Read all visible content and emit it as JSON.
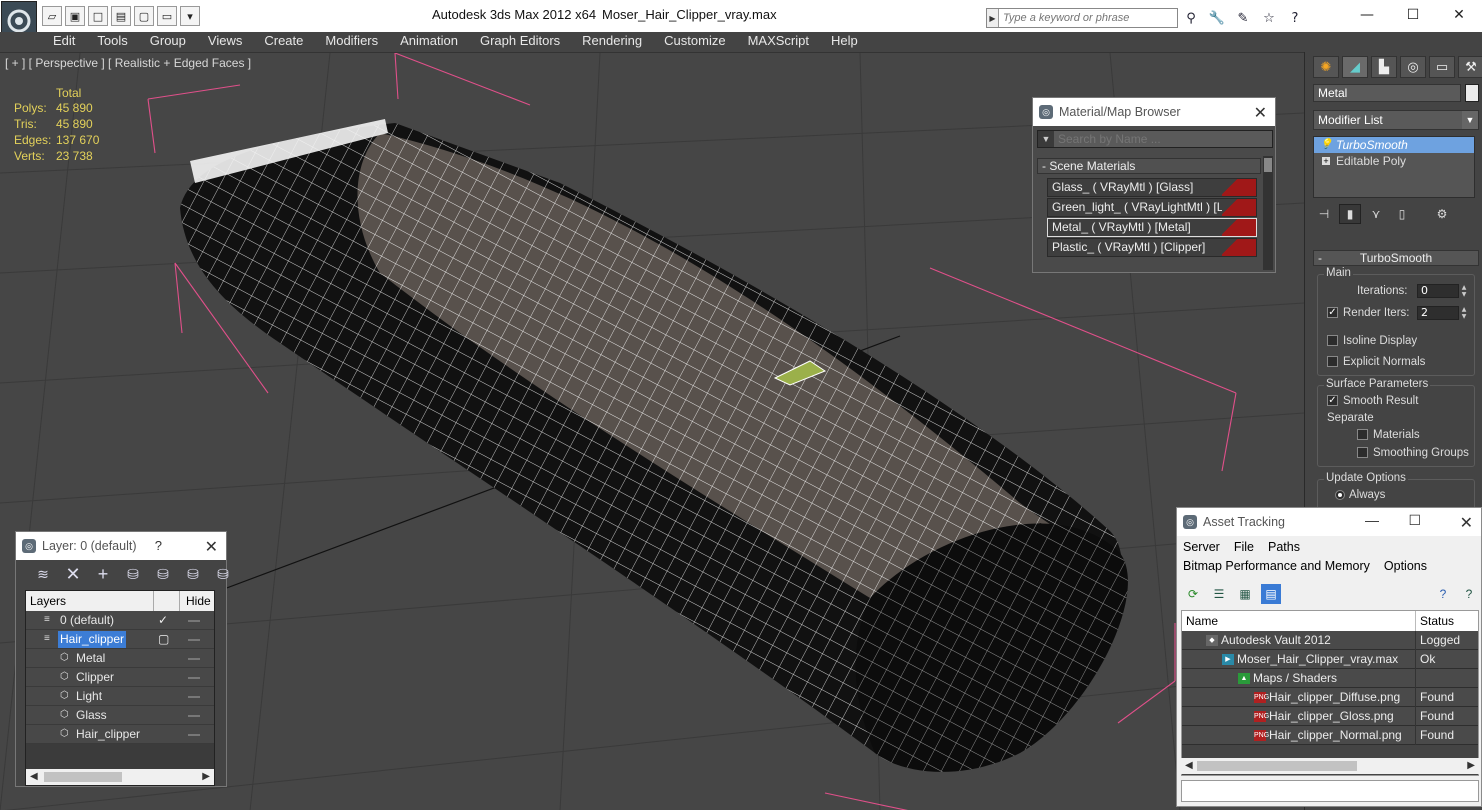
{
  "titlebar": {
    "app_title": "Autodesk 3ds Max  2012 x64",
    "file_name": "Moser_Hair_Clipper_vray.max",
    "search_placeholder": "Type a keyword or phrase"
  },
  "menu": [
    "Edit",
    "Tools",
    "Group",
    "Views",
    "Create",
    "Modifiers",
    "Animation",
    "Graph Editors",
    "Rendering",
    "Customize",
    "MAXScript",
    "Help"
  ],
  "viewport": {
    "label": "[ + ] [ Perspective ] [ Realistic + Edged Faces ]",
    "stats": {
      "header": "Total",
      "rows": [
        {
          "label": "Polys:",
          "value": "45 890"
        },
        {
          "label": "Tris:",
          "value": "45 890"
        },
        {
          "label": "Edges:",
          "value": "137 670"
        },
        {
          "label": "Verts:",
          "value": "23 738"
        }
      ]
    }
  },
  "command_panel": {
    "object_name": "Metal",
    "modifier_list": "Modifier List",
    "stack": [
      {
        "label": "TurboSmooth",
        "selected": true
      },
      {
        "label": "Editable Poly",
        "selected": false
      }
    ],
    "rollout_title": "TurboSmooth",
    "main_group": "Main",
    "iterations_label": "Iterations:",
    "iterations_value": "0",
    "render_iters_label": "Render Iters:",
    "render_iters_value": "2",
    "isoline_label": "Isoline Display",
    "explicit_normals_label": "Explicit Normals",
    "surface_group": "Surface Parameters",
    "smooth_result_label": "Smooth Result",
    "separate_label": "Separate",
    "materials_label": "Materials",
    "smoothing_groups_label": "Smoothing Groups",
    "update_group": "Update Options",
    "always_label": "Always"
  },
  "material_browser": {
    "title": "Material/Map Browser",
    "search_placeholder": "Search by Name ...",
    "section": "- Scene Materials",
    "materials": [
      {
        "label": "Glass_  ( VRayMtl ) [Glass]",
        "selected": false
      },
      {
        "label": "Green_light_  ( VRayLightMtl ) [Light]",
        "selected": false
      },
      {
        "label": "Metal_  ( VRayMtl ) [Metal]",
        "selected": true
      },
      {
        "label": "Plastic_  ( VRayMtl ) [Clipper]",
        "selected": false
      }
    ]
  },
  "layer_window": {
    "title": "Layer: 0 (default)",
    "help": "?",
    "col_layers": "Layers",
    "col_hide": "Hide",
    "rows": [
      {
        "name": "0 (default)",
        "indent": 1,
        "current": true,
        "selected": false
      },
      {
        "name": "Hair_clipper",
        "indent": 1,
        "current": false,
        "selected": true
      },
      {
        "name": "Metal",
        "indent": 2,
        "current": false,
        "selected": false
      },
      {
        "name": "Clipper",
        "indent": 2,
        "current": false,
        "selected": false
      },
      {
        "name": "Light",
        "indent": 2,
        "current": false,
        "selected": false
      },
      {
        "name": "Glass",
        "indent": 2,
        "current": false,
        "selected": false
      },
      {
        "name": "Hair_clipper",
        "indent": 2,
        "current": false,
        "selected": false
      }
    ]
  },
  "asset_tracking": {
    "title": "Asset Tracking",
    "menu1": [
      "Server",
      "File",
      "Paths"
    ],
    "menu2": [
      "Bitmap Performance and Memory",
      "Options"
    ],
    "col_name": "Name",
    "col_status": "Status",
    "rows": [
      {
        "name": "Autodesk Vault 2012",
        "status": "Logged Ou",
        "indent": 1,
        "icon": "vault-icon"
      },
      {
        "name": "Moser_Hair_Clipper_vray.max",
        "status": "Ok",
        "indent": 2,
        "icon": "max-file-icon"
      },
      {
        "name": "Maps / Shaders",
        "status": "",
        "indent": 3,
        "icon": "maps-icon"
      },
      {
        "name": "Hair_clipper_Diffuse.png",
        "status": "Found",
        "indent": 4,
        "icon": "png-icon"
      },
      {
        "name": "Hair_clipper_Gloss.png",
        "status": "Found",
        "indent": 4,
        "icon": "png-icon"
      },
      {
        "name": "Hair_clipper_Normal.png",
        "status": "Found",
        "indent": 4,
        "icon": "png-icon"
      }
    ]
  },
  "colors": {
    "stats_yellow": "#e3d15a",
    "selection_blue": "#3c7dd6",
    "material_swatch_red": "#a01818",
    "viewport_bg": "#464646"
  }
}
